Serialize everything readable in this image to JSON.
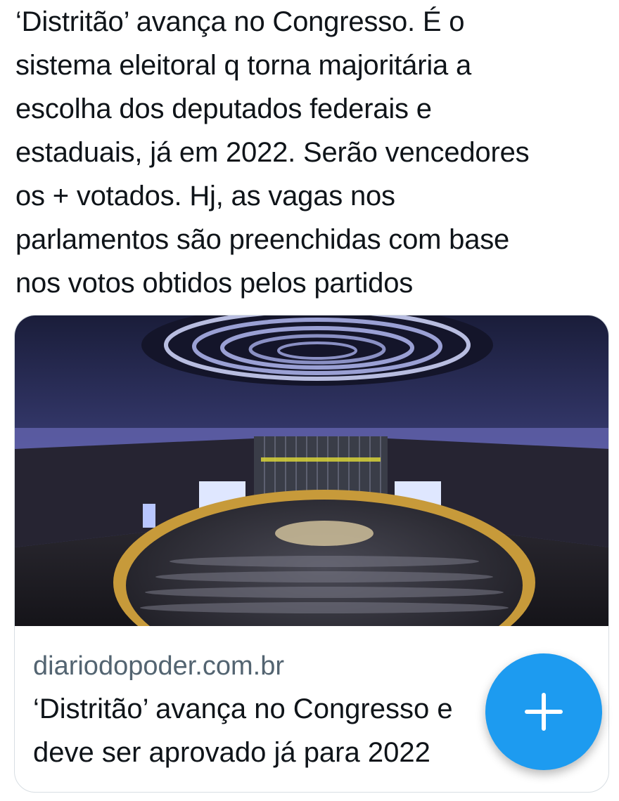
{
  "tweet": {
    "text_lines": [
      "‘Distritão’ avança no Congresso. É o",
      "sistema eleitoral q torna majoritária a",
      "escolha dos deputados federais e",
      "estaduais, já em 2022. Serão vencedores",
      "os + votados. Hj, as vagas nos",
      "parlamentos são preenchidas com base",
      "nos votos obtidos pelos partidos"
    ]
  },
  "card": {
    "domain": "diariodopoder.com.br",
    "title_lines": [
      "‘Distritão’ avança no Congresso e",
      "deve ser aprovado já para 2022"
    ]
  },
  "fab": {
    "icon": "plus-icon",
    "color": "#1d9bf0"
  }
}
